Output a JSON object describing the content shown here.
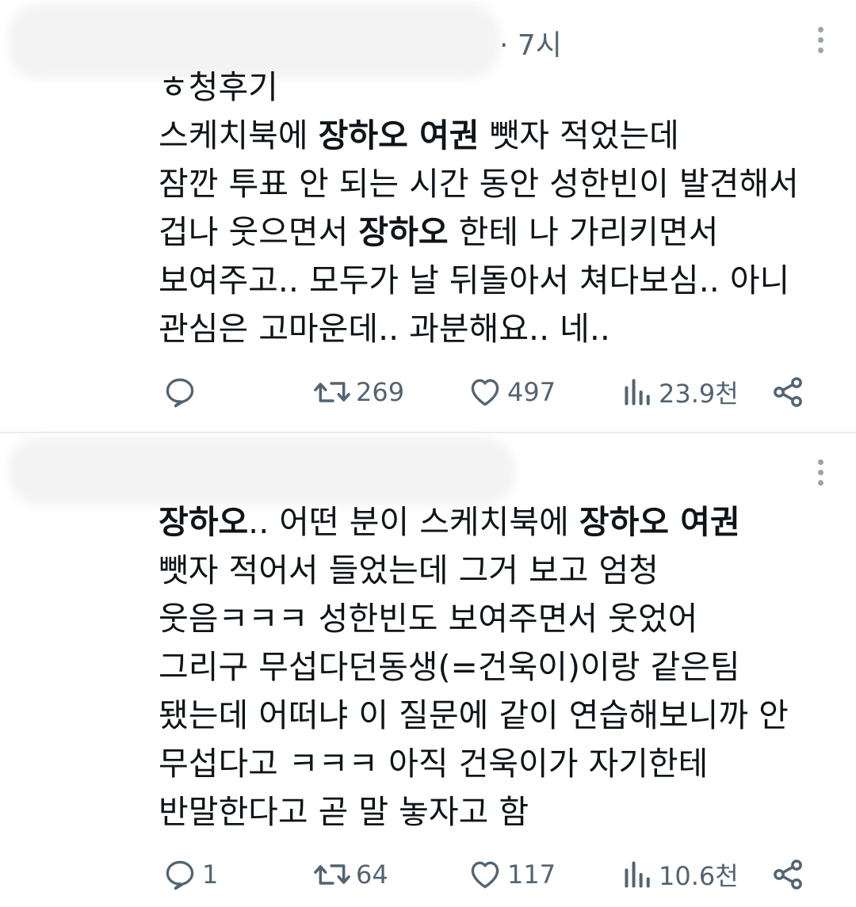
{
  "tweets": [
    {
      "time": "· 7시",
      "lines": [
        [
          {
            "t": "ㅎ청후기",
            "b": false
          }
        ],
        [
          {
            "t": "스케치북에 ",
            "b": false
          },
          {
            "t": "장하오 여권",
            "b": true
          },
          {
            "t": " 뺏자 적었는데",
            "b": false
          }
        ],
        [
          {
            "t": "잠깐 투표 안 되는 시간 동안 성한빈이 발견해서",
            "b": false
          }
        ],
        [
          {
            "t": "겁나 웃으면서 ",
            "b": false
          },
          {
            "t": "장하오",
            "b": true
          },
          {
            "t": " 한테 나 가리키면서",
            "b": false
          }
        ],
        [
          {
            "t": "보여주고.. 모두가 날 뒤돌아서 쳐다보심.. 아니",
            "b": false
          }
        ],
        [
          {
            "t": "관심은 고마운데.. 과분해요.. 네..",
            "b": false
          }
        ]
      ],
      "actions": {
        "reply": "",
        "retweet": "269",
        "like": "497",
        "views": "23.9천"
      }
    },
    {
      "time": "",
      "lines": [
        [
          {
            "t": "장하오",
            "b": true
          },
          {
            "t": ".. 어떤 분이 스케치북에 ",
            "b": false
          },
          {
            "t": "장하오 여권",
            "b": true
          }
        ],
        [
          {
            "t": "뺏자 적어서 들었는데 그거 보고 엄청",
            "b": false
          }
        ],
        [
          {
            "t": "웃음ㅋㅋㅋ 성한빈도 보여주면서 웃었어",
            "b": false
          }
        ],
        [
          {
            "t": "그리구 무섭다던동생(=건욱이)이랑 같은팀",
            "b": false
          }
        ],
        [
          {
            "t": "됐는데 어떠냐 이 질문에 같이 연습해보니까 안",
            "b": false
          }
        ],
        [
          {
            "t": "무섭다고 ㅋㅋㅋ 아직 건욱이가 자기한테",
            "b": false
          }
        ],
        [
          {
            "t": "반말한다고 곧 말 놓자고 함",
            "b": false
          }
        ]
      ],
      "actions": {
        "reply": "1",
        "retweet": "64",
        "like": "117",
        "views": "10.6천"
      }
    }
  ],
  "icons": [
    "reply-icon",
    "retweet-icon",
    "like-icon",
    "views-icon",
    "share-icon",
    "more-options-icon"
  ],
  "colors": {
    "text": "#0f1419",
    "secondary": "#536471",
    "divider": "#e6ecf0"
  }
}
